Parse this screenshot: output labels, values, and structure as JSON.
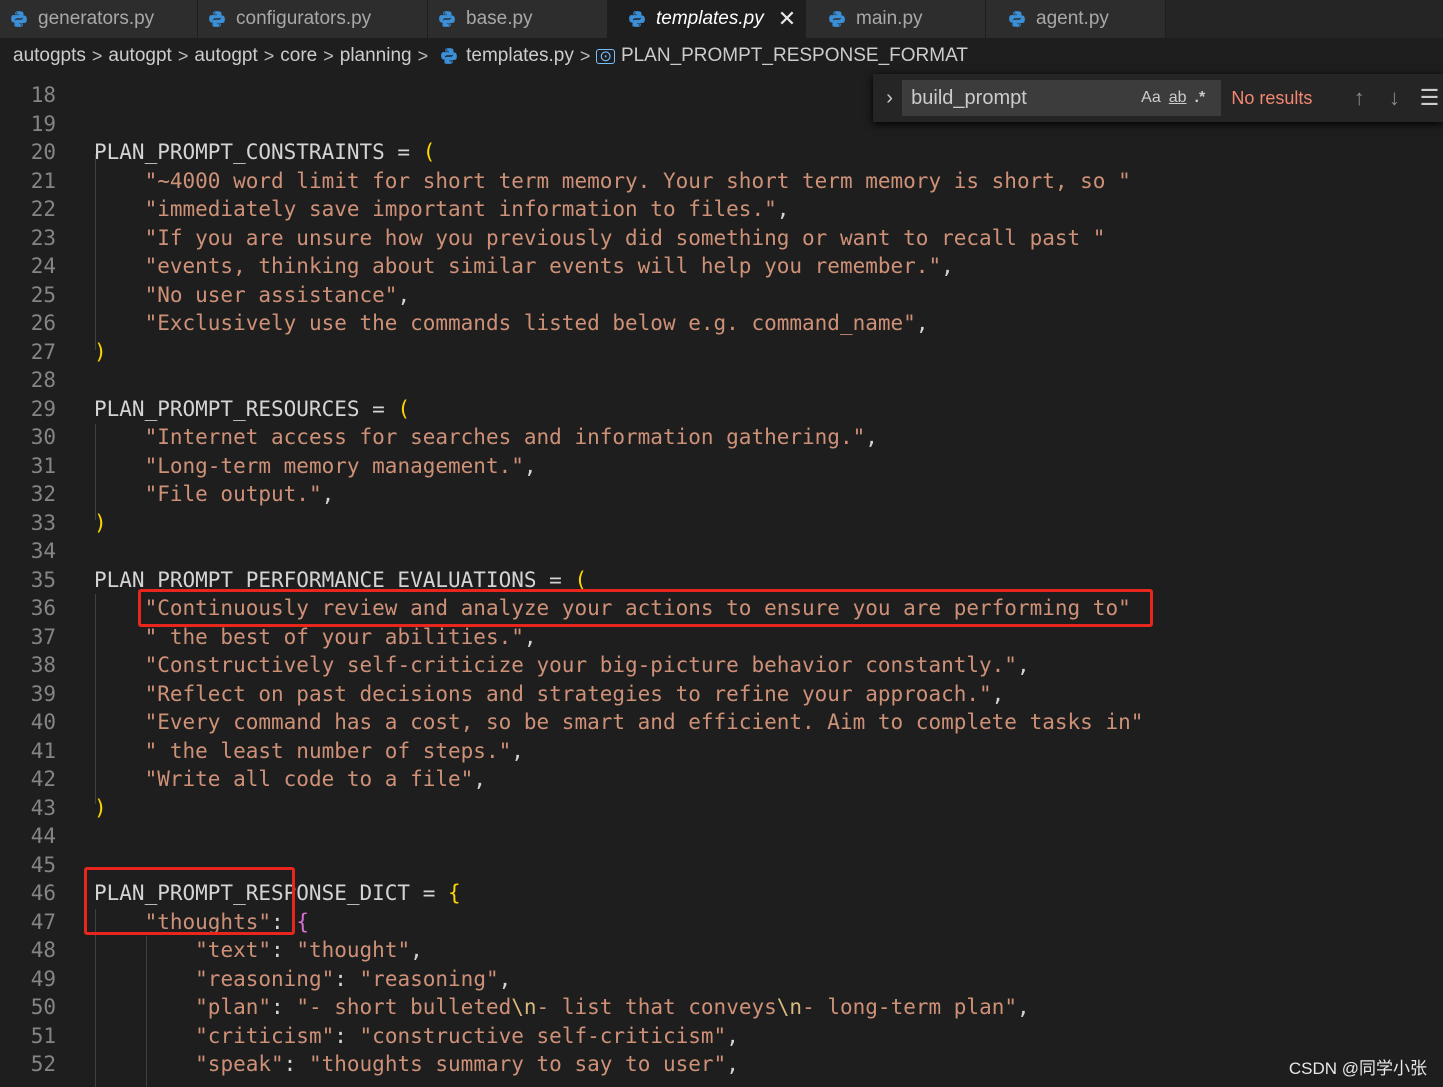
{
  "tabs": [
    {
      "label": "generators.py",
      "active": false
    },
    {
      "label": "configurators.py",
      "active": false
    },
    {
      "label": "base.py",
      "active": false
    },
    {
      "label": "templates.py",
      "active": true
    },
    {
      "label": "main.py",
      "active": false
    },
    {
      "label": "agent.py",
      "active": false
    }
  ],
  "breadcrumb": [
    "autogpts",
    "autogpt",
    "autogpt",
    "core",
    "planning",
    "templates.py",
    "PLAN_PROMPT_RESPONSE_FORMAT"
  ],
  "find": {
    "query": "build_prompt",
    "match_case": "Aa",
    "whole_word": "ab",
    "regex": ".*",
    "status": "No results"
  },
  "code_lines": [
    {
      "n": "18",
      "text": ""
    },
    {
      "n": "19",
      "text": ""
    },
    {
      "n": "20",
      "text": "PLAN_PROMPT_CONSTRAINTS = ("
    },
    {
      "n": "21",
      "text": "    \"~4000 word limit for short term memory. Your short term memory is short, so \""
    },
    {
      "n": "22",
      "text": "    \"immediately save important information to files.\","
    },
    {
      "n": "23",
      "text": "    \"If you are unsure how you previously did something or want to recall past \""
    },
    {
      "n": "24",
      "text": "    \"events, thinking about similar events will help you remember.\","
    },
    {
      "n": "25",
      "text": "    \"No user assistance\","
    },
    {
      "n": "26",
      "text": "    \"Exclusively use the commands listed below e.g. command_name\","
    },
    {
      "n": "27",
      "text": ")"
    },
    {
      "n": "28",
      "text": ""
    },
    {
      "n": "29",
      "text": "PLAN_PROMPT_RESOURCES = ("
    },
    {
      "n": "30",
      "text": "    \"Internet access for searches and information gathering.\","
    },
    {
      "n": "31",
      "text": "    \"Long-term memory management.\","
    },
    {
      "n": "32",
      "text": "    \"File output.\","
    },
    {
      "n": "33",
      "text": ")"
    },
    {
      "n": "34",
      "text": ""
    },
    {
      "n": "35",
      "text": "PLAN_PROMPT_PERFORMANCE_EVALUATIONS = ("
    },
    {
      "n": "36",
      "text": "    \"Continuously review and analyze your actions to ensure you are performing to\""
    },
    {
      "n": "37",
      "text": "    \" the best of your abilities.\","
    },
    {
      "n": "38",
      "text": "    \"Constructively self-criticize your big-picture behavior constantly.\","
    },
    {
      "n": "39",
      "text": "    \"Reflect on past decisions and strategies to refine your approach.\","
    },
    {
      "n": "40",
      "text": "    \"Every command has a cost, so be smart and efficient. Aim to complete tasks in\""
    },
    {
      "n": "41",
      "text": "    \" the least number of steps.\","
    },
    {
      "n": "42",
      "text": "    \"Write all code to a file\","
    },
    {
      "n": "43",
      "text": ")"
    },
    {
      "n": "44",
      "text": ""
    },
    {
      "n": "45",
      "text": ""
    },
    {
      "n": "46",
      "text": "PLAN_PROMPT_RESPONSE_DICT = {"
    },
    {
      "n": "47",
      "text": "    \"thoughts\": {"
    },
    {
      "n": "48",
      "text": "        \"text\": \"thought\","
    },
    {
      "n": "49",
      "text": "        \"reasoning\": \"reasoning\","
    },
    {
      "n": "50",
      "text": "        \"plan\": \"- short bulleted\\n- list that conveys\\n- long-term plan\","
    },
    {
      "n": "51",
      "text": "        \"criticism\": \"constructive self-criticism\","
    },
    {
      "n": "52",
      "text": "        \"speak\": \"thoughts summary to say to user\","
    }
  ],
  "watermark": "CSDN @同学小张",
  "colors": {
    "accent_box": "#e8261e",
    "string": "#ce9178",
    "line_number": "#858585",
    "no_results": "#f48771"
  }
}
